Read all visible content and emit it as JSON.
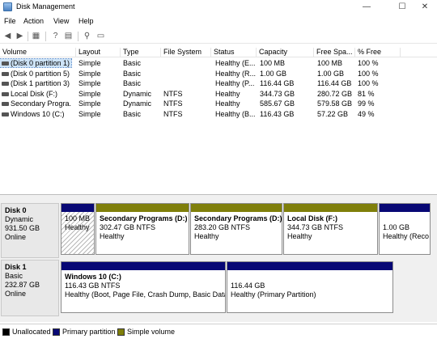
{
  "window": {
    "title": "Disk Management",
    "minimize": "—",
    "maximize": "☐",
    "close": "✕"
  },
  "menu": {
    "file": "File",
    "action": "Action",
    "view": "View",
    "help": "Help"
  },
  "volume_list": {
    "columns": [
      "Volume",
      "Layout",
      "Type",
      "File System",
      "Status",
      "Capacity",
      "Free Spa...",
      "% Free"
    ],
    "rows": [
      {
        "volume": "(Disk 0 partition 1)",
        "layout": "Simple",
        "type": "Basic",
        "fs": "",
        "status": "Healthy (E...",
        "capacity": "100 MB",
        "free": "100 MB",
        "pct": "100 %"
      },
      {
        "volume": "(Disk 0 partition 5)",
        "layout": "Simple",
        "type": "Basic",
        "fs": "",
        "status": "Healthy (R...",
        "capacity": "1.00 GB",
        "free": "1.00 GB",
        "pct": "100 %"
      },
      {
        "volume": "(Disk 1 partition 3)",
        "layout": "Simple",
        "type": "Basic",
        "fs": "",
        "status": "Healthy (P...",
        "capacity": "116.44 GB",
        "free": "116.44 GB",
        "pct": "100 %"
      },
      {
        "volume": "Local Disk (F:)",
        "layout": "Simple",
        "type": "Dynamic",
        "fs": "NTFS",
        "status": "Healthy",
        "capacity": "344.73 GB",
        "free": "280.72 GB",
        "pct": "81 %"
      },
      {
        "volume": "Secondary Progra...",
        "layout": "Simple",
        "type": "Dynamic",
        "fs": "NTFS",
        "status": "Healthy",
        "capacity": "585.67 GB",
        "free": "579.58 GB",
        "pct": "99 %"
      },
      {
        "volume": "Windows 10 (C:)",
        "layout": "Simple",
        "type": "Basic",
        "fs": "NTFS",
        "status": "Healthy (B...",
        "capacity": "116.43 GB",
        "free": "57.22 GB",
        "pct": "49 %"
      }
    ]
  },
  "disks": [
    {
      "name": "Disk 0",
      "type": "Dynamic",
      "size": "931.50 GB",
      "state": "Online",
      "partitions": [
        {
          "name": "",
          "line1": "100 MB",
          "line2": "Healthy"
        },
        {
          "name": "Secondary Programs  (D:)",
          "line1": "302.47 GB NTFS",
          "line2": "Healthy"
        },
        {
          "name": "Secondary Programs  (D:)",
          "line1": "283.20 GB NTFS",
          "line2": "Healthy"
        },
        {
          "name": "Local Disk  (F:)",
          "line1": "344.73 GB NTFS",
          "line2": "Healthy"
        },
        {
          "name": "",
          "line1": "1.00 GB",
          "line2": "Healthy (Reco"
        }
      ]
    },
    {
      "name": "Disk 1",
      "type": "Basic",
      "size": "232.87 GB",
      "state": "Online",
      "partitions": [
        {
          "name": "Windows 10  (C:)",
          "line1": "116.43 GB NTFS",
          "line2": "Healthy (Boot, Page File, Crash Dump, Basic Data P"
        },
        {
          "name": "",
          "line1": "116.44 GB",
          "line2": "Healthy (Primary Partition)"
        }
      ]
    }
  ],
  "legend": {
    "unallocated": "Unallocated",
    "primary": "Primary partition",
    "simple": "Simple volume"
  },
  "colors": {
    "primary": "#080875",
    "simple": "#7f7f0a",
    "unallocated": "#000000",
    "selection": "#cde3f7"
  }
}
